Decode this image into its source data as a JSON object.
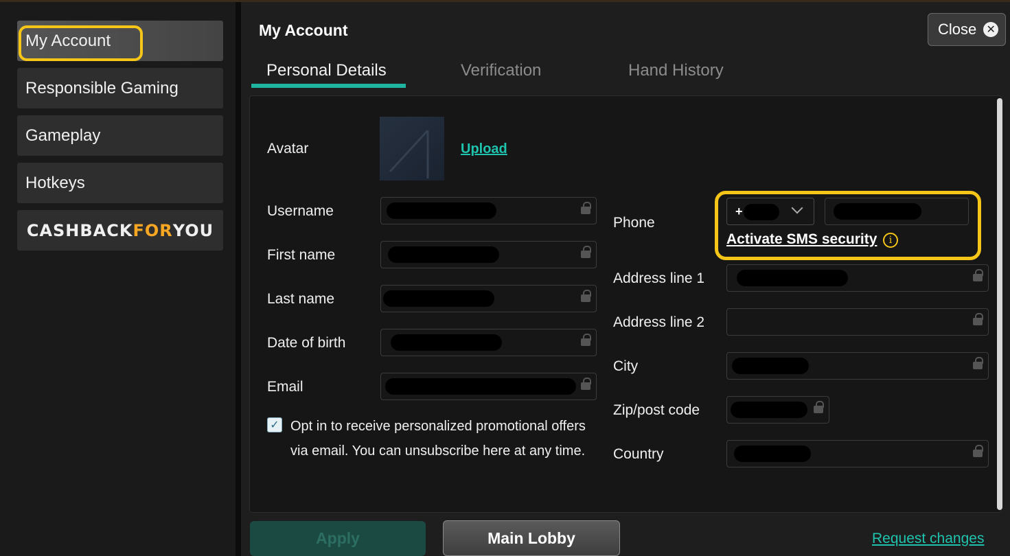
{
  "sidebar": {
    "items": [
      {
        "label": "My Account"
      },
      {
        "label": "Responsible Gaming"
      },
      {
        "label": "Gameplay"
      },
      {
        "label": "Hotkeys"
      }
    ],
    "cashback": {
      "part1": "CASHBACK ",
      "part2": "FOR",
      "part3": " YOU"
    }
  },
  "header": {
    "title": "My Account",
    "close_label": "Close"
  },
  "tabs": [
    {
      "label": "Personal Details",
      "active": true
    },
    {
      "label": "Verification",
      "active": false
    },
    {
      "label": "Hand History",
      "active": false
    }
  ],
  "form": {
    "avatar_label": "Avatar",
    "upload_label": "Upload",
    "username_label": "Username",
    "first_name_label": "First name",
    "last_name_label": "Last name",
    "dob_label": "Date of birth",
    "email_label": "Email",
    "optin_text": "Opt in to receive personalized promotional offers via email. You can unsubscribe here at any time.",
    "optin_checked": true,
    "phone_label": "Phone",
    "phone_code_prefix": "+",
    "sms_link": "Activate SMS security",
    "address1_label": "Address line 1",
    "address2_label": "Address line 2",
    "city_label": "City",
    "zip_label": "Zip/post code",
    "country_label": "Country"
  },
  "footer": {
    "apply_label": "Apply",
    "main_lobby_label": "Main Lobby",
    "request_changes_label": "Request changes"
  },
  "colors": {
    "accent": "#1fb5a0",
    "highlight": "#f5c518",
    "cashback_for": "#f5a623"
  }
}
